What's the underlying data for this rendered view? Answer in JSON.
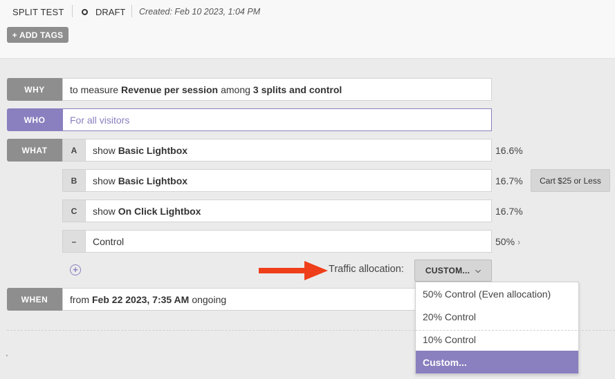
{
  "header": {
    "type": "SPLIT TEST",
    "status": "DRAFT",
    "created": "Created: Feb 10 2023, 1:04 PM",
    "add_tags": "+ ADD TAGS"
  },
  "why": {
    "label": "WHY",
    "text_pre": "to measure",
    "metric": "Revenue per session",
    "text_mid": "among",
    "splits": "3 splits and control"
  },
  "who": {
    "label": "WHO",
    "placeholder": "For all visitors"
  },
  "what": {
    "label": "WHAT",
    "variants": [
      {
        "letter": "A",
        "prefix": "show",
        "name": "Basic Lightbox",
        "percent": "16.6%"
      },
      {
        "letter": "B",
        "prefix": "show",
        "name": "Basic Lightbox",
        "percent": "16.7%",
        "segment": "Cart $25 or Less"
      },
      {
        "letter": "C",
        "prefix": "show",
        "name": "On Click Lightbox",
        "percent": "16.7%"
      },
      {
        "letter": "–",
        "prefix": "",
        "name": "Control",
        "percent": "50%"
      }
    ]
  },
  "traffic": {
    "label": "Traffic allocation:",
    "button": "CUSTOM...",
    "options": [
      "50% Control (Even allocation)",
      "20% Control",
      "10% Control",
      "Custom..."
    ],
    "selected_index": 3
  },
  "when": {
    "label": "WHEN",
    "prefix": "from",
    "date": "Feb 22 2023, 7:35 AM",
    "suffix": "ongoing"
  },
  "colors": {
    "accent": "#8a7fbf",
    "label_gray": "#8e8e8e",
    "arrow": "#ef3e1a"
  }
}
